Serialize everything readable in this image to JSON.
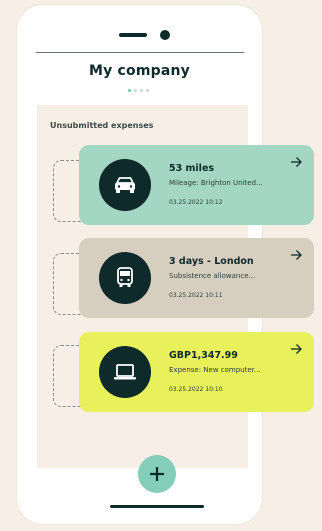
{
  "header": {
    "title": "My company"
  },
  "section": {
    "label": "Unsubmitted expenses"
  },
  "cards": [
    {
      "title": "53 miles",
      "subtitle": "Mileage: Brighton United...",
      "timestamp": "03.25.2022  10:12",
      "icon": "car-icon",
      "color": "#a3d7c3"
    },
    {
      "title": "3 days - London",
      "subtitle": "Subsistence allowance...",
      "timestamp": "03.25.2022  10:11",
      "icon": "bus-icon",
      "color": "#d6cfbf"
    },
    {
      "title": "GBP1,347.99",
      "subtitle": "Expense: New computer...",
      "timestamp": "03.25.2022  10:10",
      "icon": "laptop-icon",
      "color": "#e8f15b"
    }
  ],
  "theme": {
    "accent": "#84cdb9",
    "dark": "#0f2a2a",
    "panel_bg": "#f7efe6"
  }
}
